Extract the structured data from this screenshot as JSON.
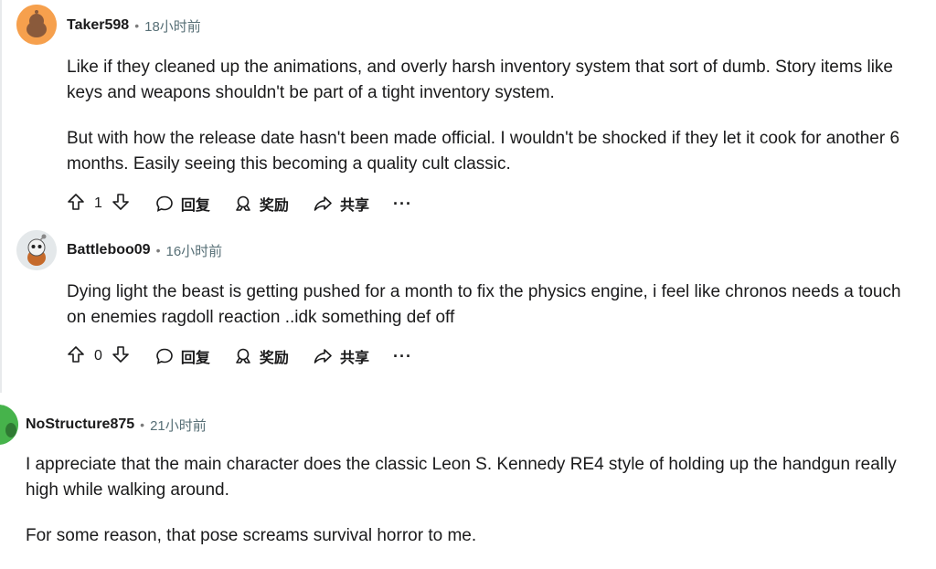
{
  "comments": [
    {
      "user": "Taker598",
      "time": "18小时前",
      "paragraphs": [
        "Like if they cleaned up the animations, and overly harsh inventory system that sort of dumb. Story items like keys and weapons shouldn't be part of a tight inventory system.",
        "But with how the release date hasn't been made official. I wouldn't be shocked if they let it cook for another 6 months. Easily seeing this becoming a quality cult classic."
      ],
      "votes": "1",
      "reply_label": "回复",
      "award_label": "奖励",
      "share_label": "共享",
      "more_label": "···"
    },
    {
      "user": "Battleboo09",
      "time": "16小时前",
      "paragraphs": [
        "Dying light the beast is getting pushed for a month to fix the physics engine, i feel like chronos needs a touch on enemies ragdoll reaction ..idk something def off"
      ],
      "votes": "0",
      "reply_label": "回复",
      "award_label": "奖励",
      "share_label": "共享",
      "more_label": "···"
    },
    {
      "user": "NoStructure875",
      "time": "21小时前",
      "paragraphs": [
        "I appreciate that the main character does the classic Leon S. Kennedy RE4 style of holding up the handgun really high while walking around.",
        "For some reason, that pose screams survival horror to me."
      ]
    }
  ],
  "separator": "•",
  "colors": {
    "avatar1": "#f6a04d",
    "avatar3": "#46b34b",
    "meta": "#576f76"
  }
}
